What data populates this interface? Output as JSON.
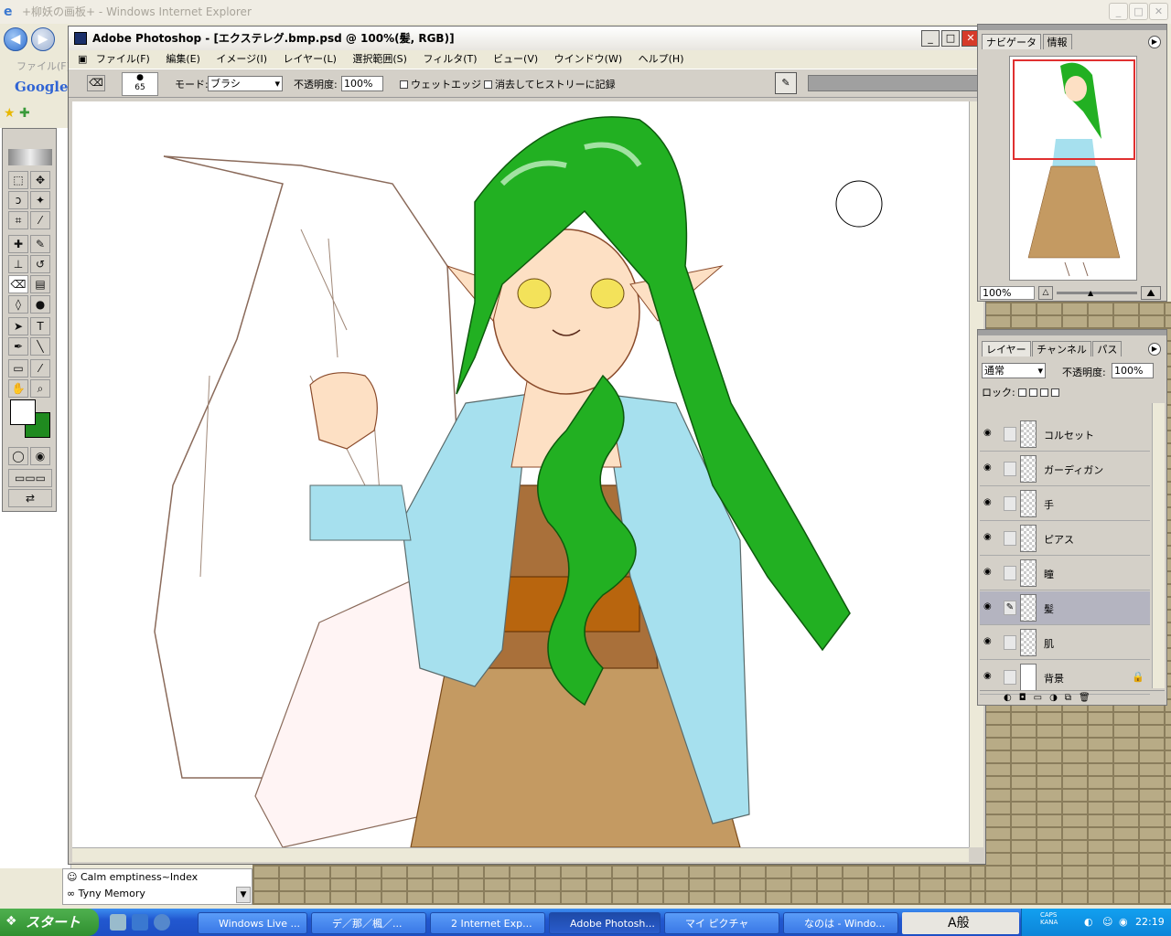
{
  "ie": {
    "title": "+柳妖の画板+ - Windows Internet Explorer",
    "menu_file": "ファイル(F)",
    "google": "Google",
    "list_items": [
      "Calm emptiness~Index",
      "Tyny  Memory"
    ]
  },
  "photoshop": {
    "title": "Adobe Photoshop - [エクステレグ.bmp.psd @ 100%(髪, RGB)]",
    "menu": [
      "ファイル(F)",
      "編集(E)",
      "イメージ(I)",
      "レイヤー(L)",
      "選択範囲(S)",
      "フィルタ(T)",
      "ビュー(V)",
      "ウインドウ(W)",
      "ヘルプ(H)"
    ],
    "options": {
      "brush_size": "65",
      "mode_label": "モード:",
      "mode_value": "ブラシ",
      "opacity_label": "不透明度:",
      "opacity_value": "100%",
      "wet_edges": "ウェットエッジ",
      "erase_history": "消去してヒストリーに記録"
    }
  },
  "navigator": {
    "tabs": [
      "ナビゲータ",
      "情報"
    ],
    "zoom": "100%"
  },
  "layers": {
    "tabs": [
      "レイヤー",
      "チャンネル",
      "パス"
    ],
    "blend": "通常",
    "opacity_label": "不透明度:",
    "opacity_value": "100%",
    "lock_label": "ロック:",
    "items": [
      {
        "name": "コルセット",
        "selected": false
      },
      {
        "name": "ガーディガン",
        "selected": false
      },
      {
        "name": "手",
        "selected": false
      },
      {
        "name": "ピアス",
        "selected": false
      },
      {
        "name": "瞳",
        "selected": false
      },
      {
        "name": "髪",
        "selected": true
      },
      {
        "name": "肌",
        "selected": false
      },
      {
        "name": "背景",
        "selected": false
      }
    ]
  },
  "taskbar": {
    "start": "スタート",
    "tasks": [
      "Windows Live ...",
      "デ／那／楓／...",
      "2 Internet Exp...",
      "Adobe Photosh...",
      "マイ ピクチャ",
      "なのは - Windo..."
    ],
    "ime": "A般",
    "caps": "CAPS",
    "kana": "KANA",
    "clock": "22:19"
  },
  "colors": {
    "foreground": "#ffffff",
    "background": "#1f8a1f",
    "hair": "#22b022",
    "cardigan": "#a6e0ee",
    "dress": "#c49a62",
    "corset": "#b8650e",
    "skin": "#fde0c4",
    "taskbar": "#245edb"
  }
}
